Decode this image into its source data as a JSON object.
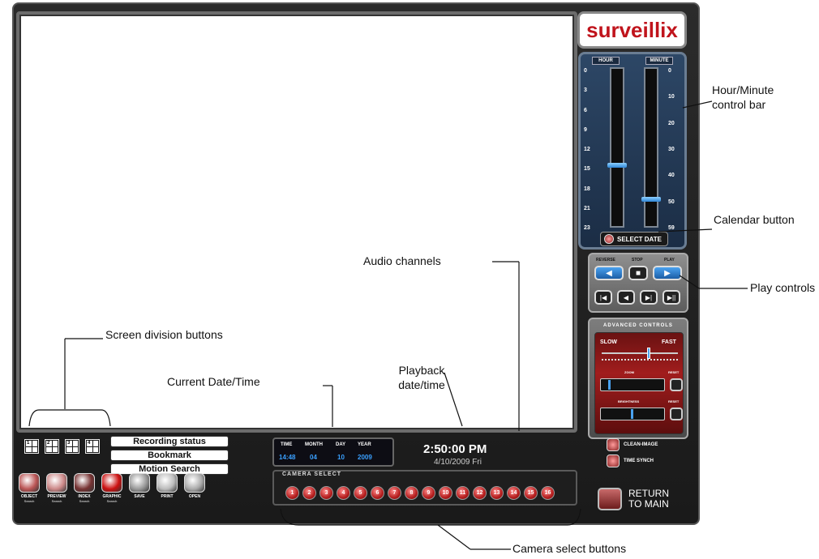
{
  "brand": {
    "logo_text": "surveillix",
    "colors": {
      "brand_red": "#c0141c",
      "video_bg": "#ffffff",
      "timebar_blue": "#2d4766",
      "advanced_red": "#a11d1d"
    }
  },
  "time_panel": {
    "hour_label": "HOUR",
    "minute_label": "MINUTE",
    "hour_ticks": [
      "0",
      "3",
      "6",
      "9",
      "12",
      "15",
      "18",
      "21",
      "23"
    ],
    "minute_ticks": [
      "0",
      "10",
      "20",
      "30",
      "40",
      "50",
      "59"
    ],
    "hour_level": 0.625,
    "minute_level": 0.85,
    "select_date_label": "SELECT DATE",
    "calendar_icon": "calendar-icon"
  },
  "play_controls": {
    "reverse_label": "REVERSE",
    "stop_label": "STOP",
    "play_label": "PLAY",
    "reverse_icon": "◀",
    "stop_icon": "■",
    "play_icon": "▶",
    "step_icons": [
      "|◀",
      "◀",
      "▶|",
      "▶||"
    ]
  },
  "advanced": {
    "title": "ADVANCED CONTROLS",
    "slow_label": "SLOW",
    "fast_label": "FAST",
    "speed_level": 0.62,
    "zoom_label": "ZOOM",
    "brightness_label": "BRIGHTNESS",
    "reset_label": "RESET",
    "zoom_level": 0.1,
    "brightness_level": 0.5
  },
  "side_buttons": {
    "clean_image_label": "CLEAN-IMAGE",
    "time_synch_label": "TIME SYNCH",
    "return_label_1": "RETURN",
    "return_label_2": "TO MAIN"
  },
  "screen_division": {
    "buttons": [
      "1",
      "2",
      "3",
      "4"
    ]
  },
  "status_labels": {
    "recording_status": "Recording status",
    "bookmark": "Bookmark",
    "motion_search": "Motion Search"
  },
  "current_datetime": {
    "time_label": "TIME",
    "month_label": "MONTH",
    "day_label": "DAY",
    "year_label": "YEAR",
    "time": "14:48",
    "month": "04",
    "day": "10",
    "year": "2009"
  },
  "playback": {
    "time": "2:50:00 PM",
    "date": "4/10/2009 Fri"
  },
  "camera_select": {
    "title": "CAMERA SELECT",
    "cameras": [
      "1",
      "2",
      "3",
      "4",
      "5",
      "6",
      "7",
      "8",
      "9",
      "10",
      "11",
      "12",
      "13",
      "14",
      "15",
      "16"
    ]
  },
  "toolbar": [
    {
      "label": "OBJECT",
      "sub": "Search"
    },
    {
      "label": "PREVIEW",
      "sub": "Search"
    },
    {
      "label": "INDEX",
      "sub": "Search"
    },
    {
      "label": "GRAPHIC",
      "sub": "Search"
    },
    {
      "label": "SAVE",
      "sub": ""
    },
    {
      "label": "PRINT",
      "sub": ""
    },
    {
      "label": "OPEN",
      "sub": ""
    }
  ],
  "annotations": {
    "hour_minute": "Hour/Minute control bar",
    "calendar": "Calendar button",
    "play": "Play controls",
    "audio": "Audio channels",
    "screen_division": "Screen division buttons",
    "current_dt": "Current Date/Time",
    "playback_dt": "Playback date/time",
    "camera_select": "Camera select buttons"
  }
}
